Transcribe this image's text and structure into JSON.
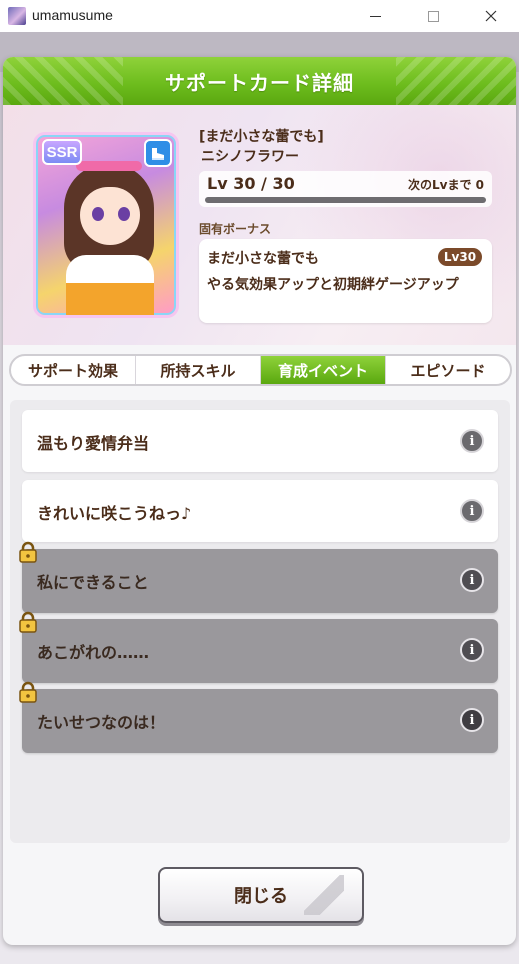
{
  "window": {
    "title": "umamusume",
    "minimize_label": "",
    "maximize_label": "",
    "close_label": ""
  },
  "dialog": {
    "title": "サポートカード詳細",
    "card": {
      "rarity": "SSR",
      "type_icon": "speed-shoe-icon",
      "subtitle": "[まだ小さな蕾でも]",
      "name": "ニシノフラワー",
      "level_text": "Lv 30 / 30",
      "next_level_text": "次のLvまで 0",
      "level_progress": 1.0
    },
    "unique_bonus": {
      "label": "固有ボーナス",
      "name": "まだ小さな蕾でも",
      "level_badge": "Lv30",
      "description": "やる気効果アップと初期絆ゲージアップ"
    },
    "tabs": [
      {
        "label": "サポート効果",
        "active": false
      },
      {
        "label": "所持スキル",
        "active": false
      },
      {
        "label": "育成イベント",
        "active": true
      },
      {
        "label": "エピソード",
        "active": false
      }
    ],
    "events": [
      {
        "title": "温もり愛情弁当",
        "locked": false
      },
      {
        "title": "きれいに咲こうねっ♪",
        "locked": false
      },
      {
        "title": "私にできること",
        "locked": true
      },
      {
        "title": "あこがれの……",
        "locked": true
      },
      {
        "title": "たいせつなのは！",
        "locked": true
      }
    ],
    "close_button": "閉じる"
  },
  "colors": {
    "header_green": "#6ebd1e",
    "text_brown": "#4b2d1a",
    "locked_row": "#9a989c"
  }
}
